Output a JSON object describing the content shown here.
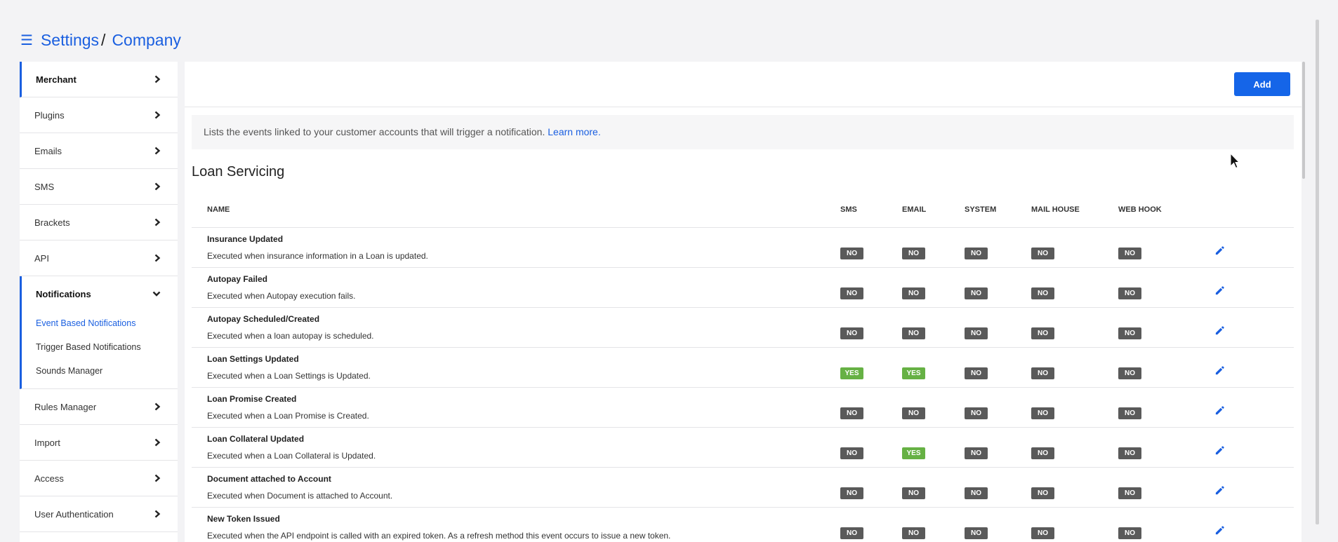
{
  "breadcrumb": {
    "menu_icon": "hamburger-menu-icon",
    "root": "Settings",
    "separator": "/",
    "current": "Company"
  },
  "sidebar": {
    "items_top": [
      {
        "label": "Merchant",
        "active": true
      },
      {
        "label": "Plugins"
      },
      {
        "label": "Emails"
      },
      {
        "label": "SMS"
      },
      {
        "label": "Brackets"
      },
      {
        "label": "API"
      }
    ],
    "group": {
      "label": "Notifications",
      "subitems": [
        {
          "label": "Event Based Notifications",
          "current": true
        },
        {
          "label": "Trigger Based Notifications"
        },
        {
          "label": "Sounds Manager"
        }
      ]
    },
    "items_bottom": [
      {
        "label": "Rules Manager"
      },
      {
        "label": "Import"
      },
      {
        "label": "Access"
      },
      {
        "label": "User Authentication"
      }
    ]
  },
  "toolbar": {
    "add_label": "Add"
  },
  "info": {
    "text": "Lists the events linked to your customer accounts that will trigger a notification. ",
    "link": "Learn more."
  },
  "section": {
    "title": "Loan Servicing"
  },
  "table": {
    "headers": {
      "name": "NAME",
      "sms": "SMS",
      "email": "EMAIL",
      "system": "SYSTEM",
      "mail_house": "MAIL HOUSE",
      "web_hook": "WEB HOOK"
    },
    "rows": [
      {
        "title": "Insurance Updated",
        "desc": "Executed when insurance information in a Loan is updated.",
        "sms": "NO",
        "email": "NO",
        "system": "NO",
        "mail_house": "NO",
        "web_hook": "NO"
      },
      {
        "title": "Autopay Failed",
        "desc": "Executed when Autopay execution fails.",
        "sms": "NO",
        "email": "NO",
        "system": "NO",
        "mail_house": "NO",
        "web_hook": "NO"
      },
      {
        "title": "Autopay Scheduled/Created",
        "desc": "Executed when a loan autopay is scheduled.",
        "sms": "NO",
        "email": "NO",
        "system": "NO",
        "mail_house": "NO",
        "web_hook": "NO"
      },
      {
        "title": "Loan Settings Updated",
        "desc": "Executed when a Loan Settings is Updated.",
        "sms": "YES",
        "email": "YES",
        "system": "NO",
        "mail_house": "NO",
        "web_hook": "NO"
      },
      {
        "title": "Loan Promise Created",
        "desc": "Executed when a Loan Promise is Created.",
        "sms": "NO",
        "email": "NO",
        "system": "NO",
        "mail_house": "NO",
        "web_hook": "NO"
      },
      {
        "title": "Loan Collateral Updated",
        "desc": "Executed when a Loan Collateral is Updated.",
        "sms": "NO",
        "email": "YES",
        "system": "NO",
        "mail_house": "NO",
        "web_hook": "NO"
      },
      {
        "title": "Document attached to Account",
        "desc": "Executed when Document is attached to Account.",
        "sms": "NO",
        "email": "NO",
        "system": "NO",
        "mail_house": "NO",
        "web_hook": "NO"
      },
      {
        "title": "New Token Issued",
        "desc": "Executed when the API endpoint is called with an expired token. As a refresh method this event occurs to issue a new token.",
        "sms": "NO",
        "email": "NO",
        "system": "NO",
        "mail_house": "NO",
        "web_hook": "NO"
      }
    ]
  },
  "colors": {
    "accent": "#1a5fe0",
    "yes_badge": "#66b144",
    "no_badge": "#5a5a5a"
  },
  "icons": {
    "chevron_right": "chevron-right-icon",
    "chevron_down": "chevron-down-icon",
    "edit": "pencil-edit-icon"
  }
}
